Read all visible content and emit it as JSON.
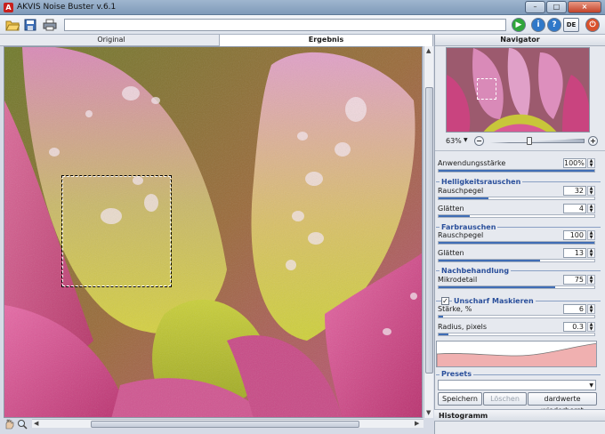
{
  "window": {
    "title": "AKVIS Noise Buster v.6.1",
    "app_icon_letter": "A",
    "minimize": "–",
    "maximize": "□",
    "close": "×"
  },
  "toolbar": {
    "path": "",
    "run_symbol": "▶",
    "info_symbol": "i",
    "help_symbol": "?",
    "language": "DE",
    "settings_symbol": "⏻"
  },
  "tabs": [
    {
      "label": "Original",
      "active": false
    },
    {
      "label": "Ergebnis",
      "active": true
    }
  ],
  "navigator": {
    "title": "Navigator",
    "zoom": "63%",
    "zoom_minus": "−",
    "zoom_plus": "+"
  },
  "params": {
    "strength": {
      "label": "Anwendungsstärke",
      "value": "100%",
      "fraction": 1.0
    },
    "brightness_group": "Helligkeitsrauschen",
    "b_noise": {
      "label": "Rauschpegel",
      "value": "32",
      "fraction": 0.32
    },
    "b_smooth": {
      "label": "Glätten",
      "value": "4",
      "fraction": 0.2
    },
    "color_group": "Farbrauschen",
    "c_noise": {
      "label": "Rauschpegel",
      "value": "100",
      "fraction": 1.0
    },
    "c_smooth": {
      "label": "Glätten",
      "value": "13",
      "fraction": 0.65
    },
    "post_group": "Nachbehandlung",
    "micro": {
      "label": "Mikrodetail",
      "value": "75",
      "fraction": 0.75
    },
    "unsharp_group": "Unscharf Maskieren",
    "unsharp_checked": "✓",
    "amount": {
      "label": "Stärke, %",
      "value": "6",
      "fraction": 0.03
    },
    "radius": {
      "label": "Radius, pixels",
      "value": "0.3",
      "fraction": 0.06
    }
  },
  "presets": {
    "title": "Presets",
    "selected": "",
    "save_label": "Speichern",
    "delete_label": "Löschen",
    "reset_label": "dardwerte wiederherst"
  },
  "histogram": {
    "title": "Histogramm"
  },
  "colors": {
    "accent": "#3f6db5",
    "group_title": "#2a4f9b",
    "run_green": "#2fa63a",
    "info_blue": "#2f78c9",
    "exit_red": "#d9512c"
  },
  "icons": [
    "open-file-icon",
    "save-file-icon",
    "print-icon",
    "run-icon",
    "info-icon",
    "help-icon",
    "settings-icon",
    "hand-tool-icon",
    "zoom-tool-icon"
  ]
}
